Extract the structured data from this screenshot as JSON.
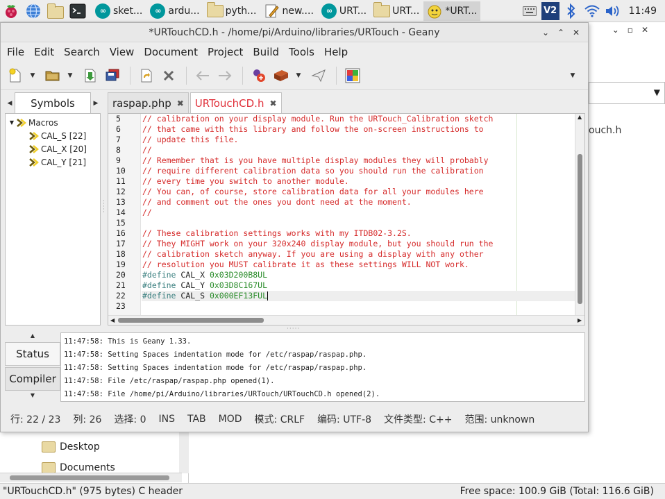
{
  "taskbar": {
    "tasks": [
      {
        "label": "sket...",
        "icon": "arduino-icon"
      },
      {
        "label": "ardu...",
        "icon": "arduino-icon"
      },
      {
        "label": "pyth...",
        "icon": "folder-icon"
      },
      {
        "label": "new....",
        "icon": "text-editor-icon"
      },
      {
        "label": "URT...",
        "icon": "arduino-icon"
      },
      {
        "label": "URT...",
        "icon": "folder-icon"
      },
      {
        "label": "*URT...",
        "icon": "geany-icon"
      }
    ],
    "clock": "11:49",
    "vnc_label": "V2"
  },
  "geany": {
    "title": "*URTouchCD.h - /home/pi/Arduino/libraries/URTouch - Geany",
    "menu": [
      "File",
      "Edit",
      "Search",
      "View",
      "Document",
      "Project",
      "Build",
      "Tools",
      "Help"
    ],
    "sidebar": {
      "tab_label": "Symbols",
      "group": "Macros",
      "items": [
        "CAL_S [22]",
        "CAL_X [20]",
        "CAL_Y [21]"
      ]
    },
    "tabs": [
      {
        "label": "raspap.php",
        "active": false
      },
      {
        "label": "URTouchCD.h",
        "active": true
      }
    ],
    "editor": {
      "current_line": 22,
      "lines": [
        {
          "n": "5",
          "type": "comment",
          "text": "// calibration on your display module. Run the URTouch_Calibration sketch"
        },
        {
          "n": "6",
          "type": "comment",
          "text": "// that came with this library and follow the on-screen instructions to"
        },
        {
          "n": "7",
          "type": "comment",
          "text": "// update this file."
        },
        {
          "n": "8",
          "type": "comment",
          "text": "//"
        },
        {
          "n": "9",
          "type": "comment",
          "text": "// Remember that is you have multiple display modules they will probably"
        },
        {
          "n": "10",
          "type": "comment",
          "text": "// require different calibration data so you should run the calibration"
        },
        {
          "n": "11",
          "type": "comment",
          "text": "// every time you switch to another module."
        },
        {
          "n": "12",
          "type": "comment",
          "text": "// You can, of course, store calibration data for all your modules here"
        },
        {
          "n": "13",
          "type": "comment",
          "text": "// and comment out the ones you dont need at the moment."
        },
        {
          "n": "14",
          "type": "comment",
          "text": "//"
        },
        {
          "n": "15",
          "type": "blank",
          "text": ""
        },
        {
          "n": "16",
          "type": "comment",
          "text": "// These calibration settings works with my ITDB02-3.2S."
        },
        {
          "n": "17",
          "type": "comment",
          "text": "// They MIGHT work on your 320x240 display module, but you should run the"
        },
        {
          "n": "18",
          "type": "comment",
          "text": "// calibration sketch anyway. If you are using a display with any other"
        },
        {
          "n": "19",
          "type": "comment",
          "text": "// resolution you MUST calibrate it as these settings WILL NOT work."
        },
        {
          "n": "20",
          "type": "define",
          "directive": "#define",
          "name": "CAL_X",
          "value": "0x03D200B8UL"
        },
        {
          "n": "21",
          "type": "define",
          "directive": "#define",
          "name": "CAL_Y",
          "value": "0x03D8C167UL"
        },
        {
          "n": "22",
          "type": "define",
          "directive": "#define",
          "name": "CAL_S",
          "value": "0x000EF13FUL"
        },
        {
          "n": "23",
          "type": "blank",
          "text": ""
        }
      ]
    },
    "message_tabs": [
      "Status",
      "Compiler"
    ],
    "messages": [
      "11:47:58: This is Geany 1.33.",
      "11:47:58: Setting Spaces indentation mode for /etc/raspap/raspap.php.",
      "11:47:58: Setting Spaces indentation mode for /etc/raspap/raspap.php.",
      "11:47:58: File /etc/raspap/raspap.php opened(1).",
      "11:47:58: File /home/pi/Arduino/libraries/URTouch/URTouchCD.h opened(2)."
    ],
    "status": {
      "line": "行: 22 / 23",
      "col": "列: 26",
      "sel": "选择: 0",
      "ins": "INS",
      "tab": "TAB",
      "mod": "MOD",
      "eol": "模式: CRLF",
      "enc": "编码: UTF-8",
      "ftype": "文件类型: C++",
      "scope": "范围: unknown"
    }
  },
  "filemanager": {
    "file_label": "ouch.h",
    "places": [
      "Desktop",
      "Documents"
    ],
    "status_left": "\"URTouchCD.h\" (975 bytes) C header",
    "status_right": "Free space: 100.9 GiB (Total: 116.6 GiB)"
  },
  "colors": {
    "comment": "#d52a2a",
    "preprocessor": "#3a7f7f",
    "number": "#2a8c2a",
    "active_tab": "#e0303a"
  }
}
